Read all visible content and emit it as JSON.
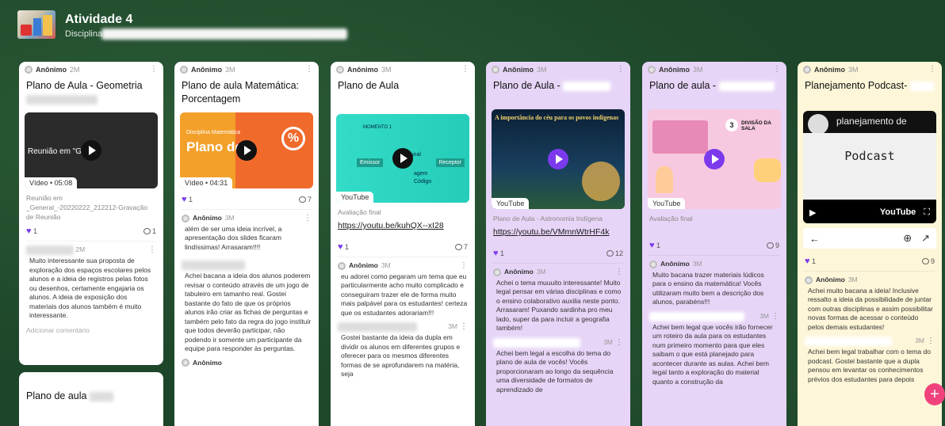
{
  "board": {
    "title": "Atividade 4",
    "subtitle": "Disciplina"
  },
  "col1": {
    "card1": {
      "author": "Anônimo",
      "time": "2M",
      "title": "Plano de Aula - Geometria",
      "thumb_caption": "Reunião em \"Ge",
      "thumb_caption2": "l\"",
      "video_label": "Vídeo • 05:08",
      "meta": "Reunião em _General_-20220222_212212-Gravação de Reunião",
      "likes": "1",
      "comments": "1",
      "comment_time": "2M",
      "comment_text": "Muito interessante sua proposta de exploração dos espaços escolares pelos alunos e a ideia de registros pelas fotos ou desenhos, certamente engajaria os alunos. A ideia de exposição dos materiais dos alunos também é muito interessante.",
      "add_comment": "Adicionar comentário"
    },
    "card2": {
      "title": "Plano de aula"
    }
  },
  "col2": {
    "author": "Anônimo",
    "time": "3M",
    "title": "Plano de aula Matemática: Porcentagem",
    "thumb_small": "Disciplina Matemática",
    "thumb_big": "Plano de a",
    "video_label": "Vídeo • 04:31",
    "likes": "1",
    "comments": "7",
    "comment1_author": "Anônimo",
    "comment1_time": "3M",
    "comment1_text": "além de ser uma ideia incrível, a apresentação dos slides ficaram lindíssimas! Arrasaram!!!!",
    "comment2_text": "Achei bacana a ideia dos alunos poderem revisar o conteúdo através de um jogo de tabuleiro em tamanho real. Gostei bastante do fato de que os próprios alunos irão criar as fichas de perguntas e também pelo fato da regra do jogo instituir que todos deverão participar, não podendo ir somente um participante da equipe para responder às perguntas.",
    "comment3_author": "Anônimo"
  },
  "col3": {
    "author": "Anônimo",
    "time": "3M",
    "title": "Plano de Aula",
    "slide_label": "MOMENTO 1",
    "slide_emissor": "Emissor",
    "slide_receptor": "Receptor",
    "slide_c1": "inal",
    "slide_c2": "agem",
    "slide_c3": "Código",
    "source": "YouTube",
    "meta": "Avaliação final",
    "url": "https://youtu.be/kuhQX--xI28",
    "likes": "1",
    "comments": "7",
    "comment1_author": "Anônimo",
    "comment1_time": "3M",
    "comment1_text": "eu adorei como pegaram um tema que eu particularmente acho muito complicado e conseguiram trazer ele de forma muito mais palpável para os estudantes! certeza que os estudantes adorariam!!!",
    "comment2_time": "3M",
    "comment2_text": "Gostei bastante da ideia da dupla em dividir os alunos em diferentes grupos e oferecer para os mesmos diferentes formas de se aprofundarem na matéria, seja"
  },
  "col4": {
    "author": "Anônimo",
    "time": "3M",
    "title": "Plano de Aula -",
    "thumb_title": "A importância do céu para os povos indígenas",
    "source": "YouTube",
    "meta": "Plano de Aula - Astronomia Indígena",
    "url": "https://youtu.be/VMmnWtrHF4k",
    "likes": "1",
    "comments": "12",
    "comment1_author": "Anônimo",
    "comment1_time": "3M",
    "comment1_text": "Achei o tema muuuito interessante! Muito legal pensar em várias disciplinas e como o ensino colaborativo auxilia neste ponto. Arrasaram! Puxando sardinha pro meu lado, super da para incluir a geografia também!",
    "comment2_time": "3M",
    "comment2_text": "Achei bem legal a escolha do tema do plano de aula de vocês! Vocês proporcionaram ao longo da sequência uma diversidade de formatos de aprendizado de"
  },
  "col5": {
    "author": "Anônimo",
    "time": "3M",
    "title": "Plano de aula -",
    "thumb_num": "3",
    "thumb_title": "DIVISÃO DA SALA",
    "source": "YouTube",
    "meta": "Avaliação final",
    "likes": "1",
    "comments": "9",
    "comment1_author": "Anônimo",
    "comment1_time": "3M",
    "comment1_text": "Muito bacana trazer materiais lúdicos para o ensino da matemática! Vocês utilizaram muito bem a descrição dos alunos, parabéns!!!",
    "comment2_time": "3M",
    "comment2_text": "Achei bem legal que vocês irão fornecer um roteiro da aula para os estudantes num primeiro momento para que eles saibam o que está planejado para acontecer durante as aulas. Achei bem legal tanto a exploração do material quanto a construção da"
  },
  "col6": {
    "author": "Anônimo",
    "time": "3M",
    "title": "Planejamento Podcast-",
    "pod_top": "planejamento de",
    "pod_word": "Podcast",
    "pod_brand": "YouTube",
    "likes": "1",
    "comments": "9",
    "comment1_author": "Anônimo",
    "comment1_time": "3M",
    "comment1_text": "Achei muito bacana a ideia! Inclusive ressalto a ideia da possibilidade de juntar com outras disciplinas e assim possibilitar novas formas de acessar o conteúdo pelos demais estudantes!",
    "comment2_time": "3M",
    "comment2_text": "Achei bem legal trabalhar com o tema do podcast. Gostei bastante que a dupla pensou em levantar os conhecimentos prévios dos estudantes para depois"
  },
  "fab": "+"
}
